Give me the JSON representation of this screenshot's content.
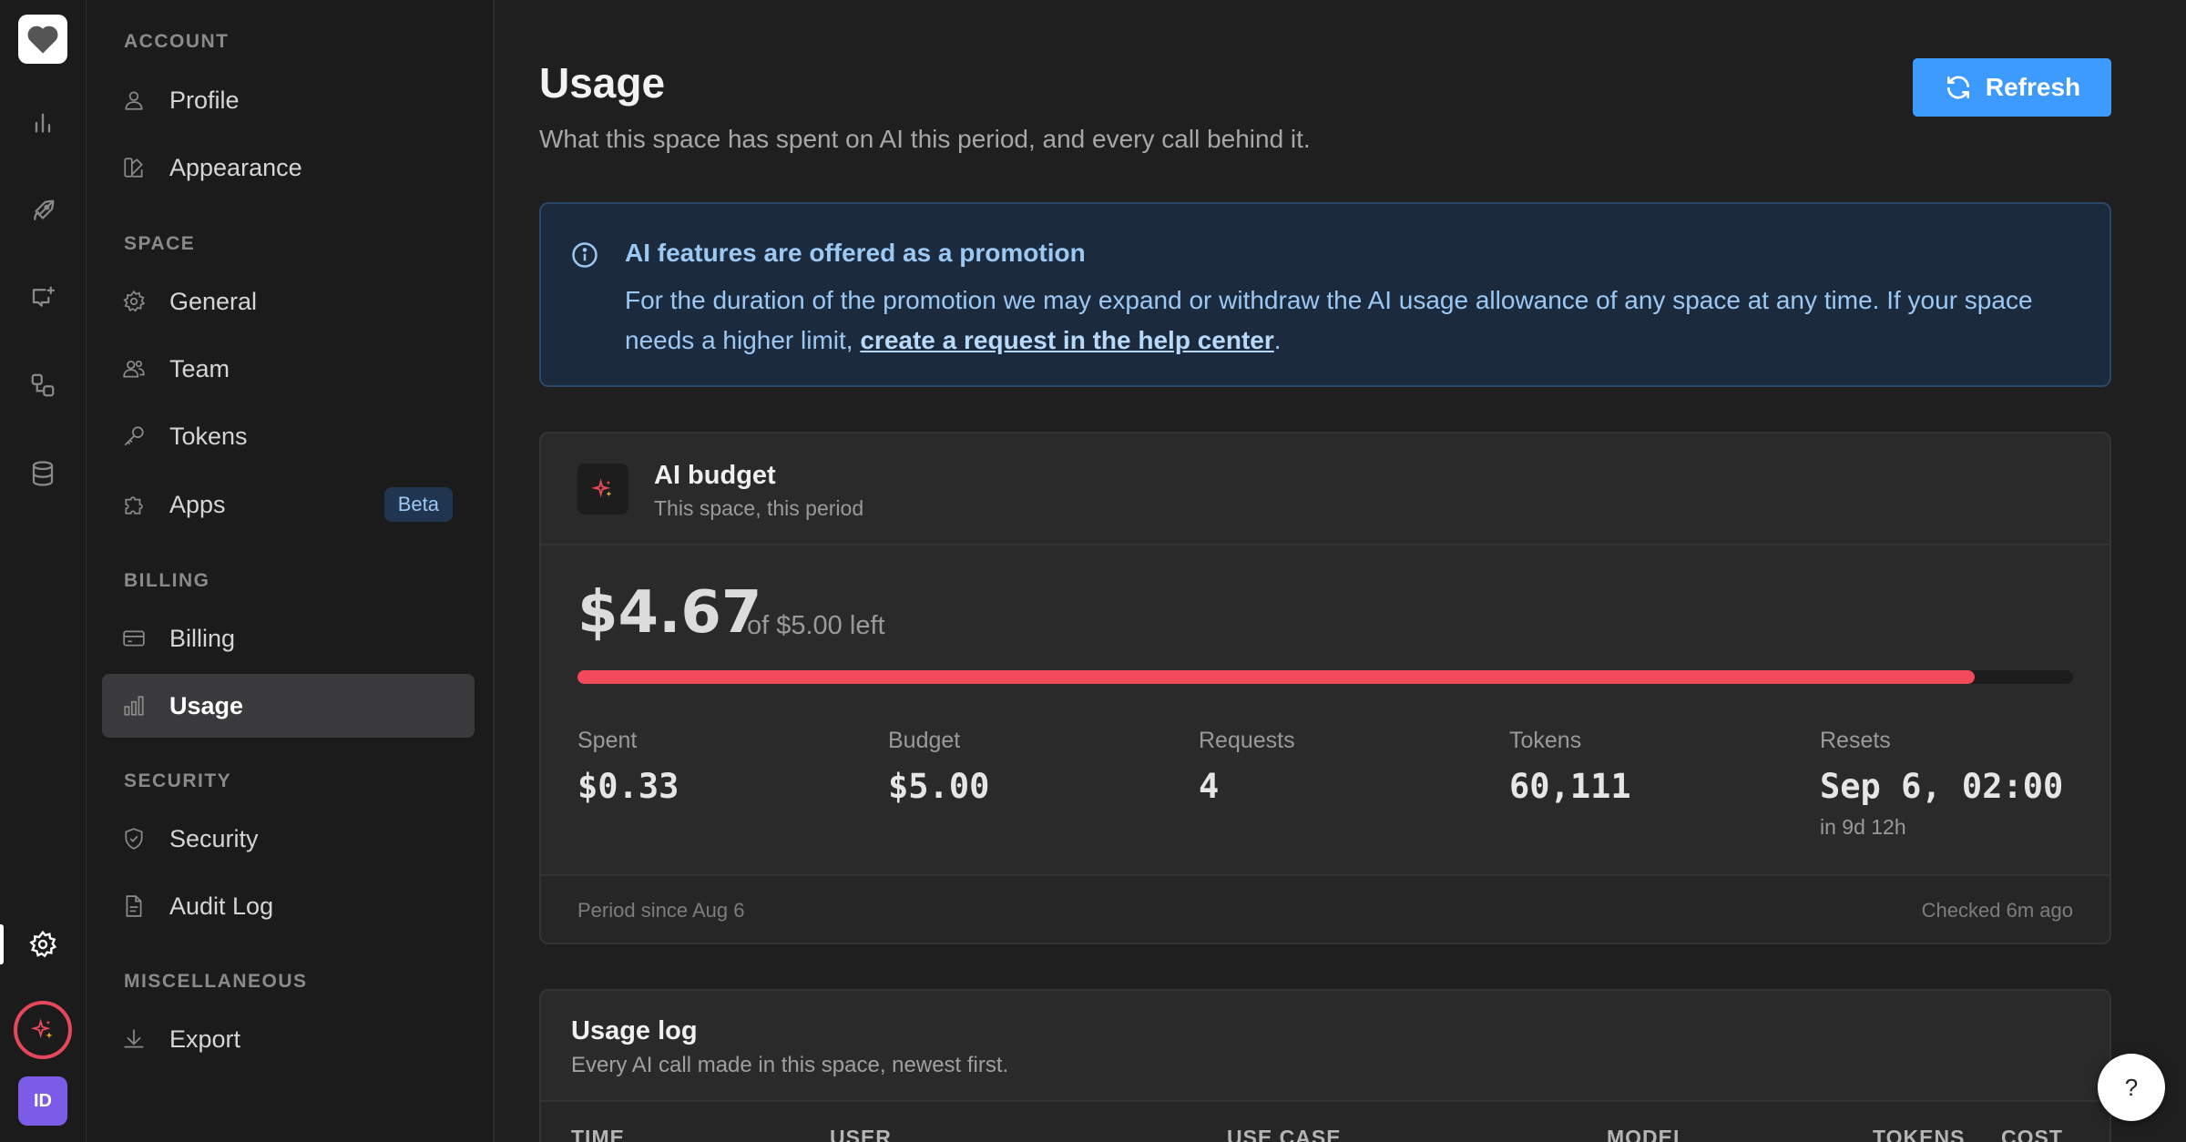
{
  "rail": {
    "icons": [
      "heart-logo-icon",
      "bar-chart-icon",
      "rocket-icon",
      "chat-sparkle-icon",
      "workflow-icon",
      "database-icon",
      "gear-icon",
      "ai-sparkle-icon"
    ],
    "avatar_initials": "ID"
  },
  "sidebar": {
    "sections": [
      {
        "title": "ACCOUNT",
        "items": [
          {
            "label": "Profile",
            "icon": "user-icon"
          },
          {
            "label": "Appearance",
            "icon": "palette-icon"
          }
        ]
      },
      {
        "title": "SPACE",
        "items": [
          {
            "label": "General",
            "icon": "gear-icon"
          },
          {
            "label": "Team",
            "icon": "users-icon"
          },
          {
            "label": "Tokens",
            "icon": "key-icon"
          },
          {
            "label": "Apps",
            "icon": "puzzle-icon",
            "badge": "Beta"
          }
        ]
      },
      {
        "title": "BILLING",
        "items": [
          {
            "label": "Billing",
            "icon": "credit-card-icon"
          },
          {
            "label": "Usage",
            "icon": "bar-chart-icon",
            "active": true
          }
        ]
      },
      {
        "title": "SECURITY",
        "items": [
          {
            "label": "Security",
            "icon": "shield-icon"
          },
          {
            "label": "Audit Log",
            "icon": "document-icon"
          }
        ]
      },
      {
        "title": "MISCELLANEOUS",
        "items": [
          {
            "label": "Export",
            "icon": "download-icon"
          }
        ]
      }
    ]
  },
  "header": {
    "title": "Usage",
    "subtitle": "What this space has spent on AI this period, and every call behind it.",
    "refresh_label": "Refresh"
  },
  "banner": {
    "title": "AI features are offered as a promotion",
    "body": "For the duration of the promotion we may expand or withdraw the AI usage allowance of any space at any time. If your space needs a higher limit, ",
    "link": "create a request in the help center",
    "end": "."
  },
  "budget": {
    "title": "AI budget",
    "subtitle": "This space, this period",
    "remaining": "$4.67",
    "of_text": "of $5.00 left",
    "remaining_fraction": 0.934,
    "stats": [
      {
        "label": "Spent",
        "value": "$0.33",
        "sub": ""
      },
      {
        "label": "Budget",
        "value": "$5.00",
        "sub": ""
      },
      {
        "label": "Requests",
        "value": "4",
        "sub": ""
      },
      {
        "label": "Tokens",
        "value": "60,111",
        "sub": ""
      },
      {
        "label": "Resets",
        "value": "Sep 6, 02:00",
        "sub": "in 9d 12h"
      }
    ],
    "footer_left": "Period since Aug 6",
    "footer_right": "Checked 6m ago"
  },
  "usage_log": {
    "title": "Usage log",
    "subtitle": "Every AI call made in this space, newest first.",
    "columns": [
      "TIME",
      "USER",
      "USE CASE",
      "MODEL",
      "TOKENS",
      "COST"
    ]
  },
  "help_label": "?",
  "colors": {
    "accent": "#3d9bff",
    "bar_fill": "#f24a5a",
    "banner_text": "#9cc8f4"
  }
}
